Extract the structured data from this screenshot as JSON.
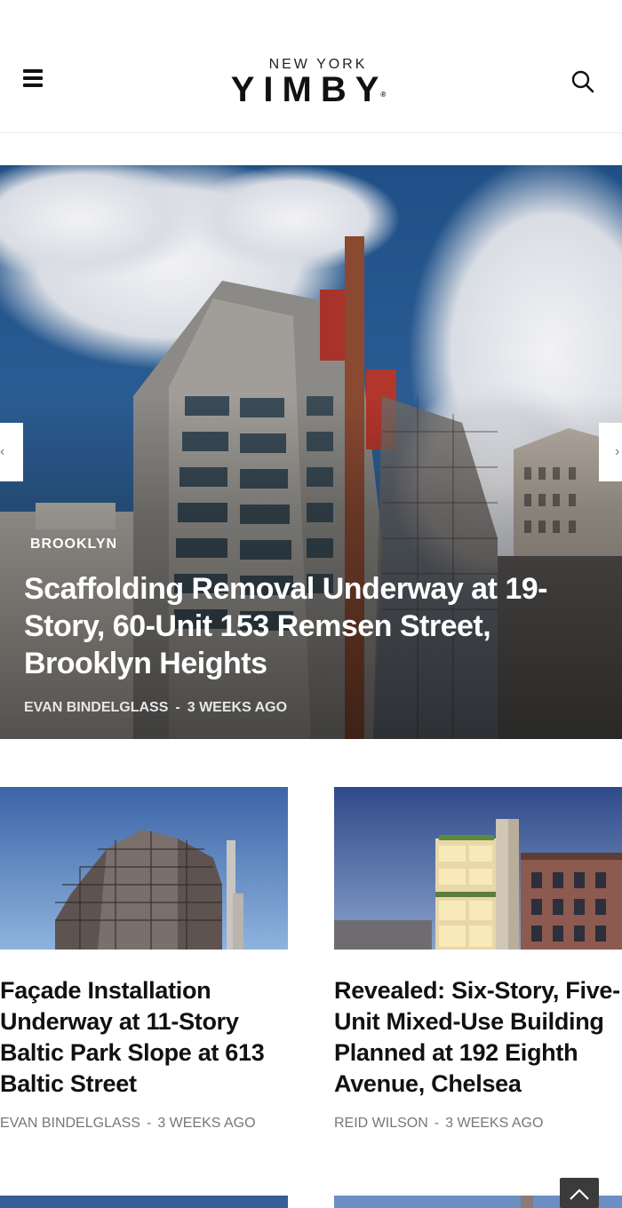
{
  "header": {
    "logo_top": "NEW YORK",
    "logo_main": "YIMBY",
    "logo_mark": "®"
  },
  "hero": {
    "category": "BROOKLYN",
    "title": "Scaffolding Removal Underway at 19-Story, 60-Unit 153 Remsen Street, Brooklyn Heights",
    "author": "EVAN BINDELGLASS",
    "separator": "-",
    "time": "3 WEEKS AGO"
  },
  "articles": [
    {
      "title": "Façade Installation Underway at 11-Story Baltic Park Slope at 613 Baltic Street",
      "author": "EVAN BINDELGLASS",
      "separator": "-",
      "time": "3 WEEKS AGO"
    },
    {
      "title": "Revealed: Six-Story, Five-Unit Mixed-Use Building Planned at 192 Eighth Avenue, Chelsea",
      "author": "REID WILSON",
      "separator": "-",
      "time": "3 WEEKS AGO"
    }
  ],
  "icons": {
    "menu": "hamburger-icon",
    "search": "search-icon",
    "prev": "chevron-left-icon",
    "next": "chevron-right-icon",
    "scroll_top": "chevron-up-icon"
  },
  "colors": {
    "text": "#111111",
    "meta": "#777777",
    "sky": "#2e5a8c",
    "scroll_button": "#3b3b3b"
  }
}
